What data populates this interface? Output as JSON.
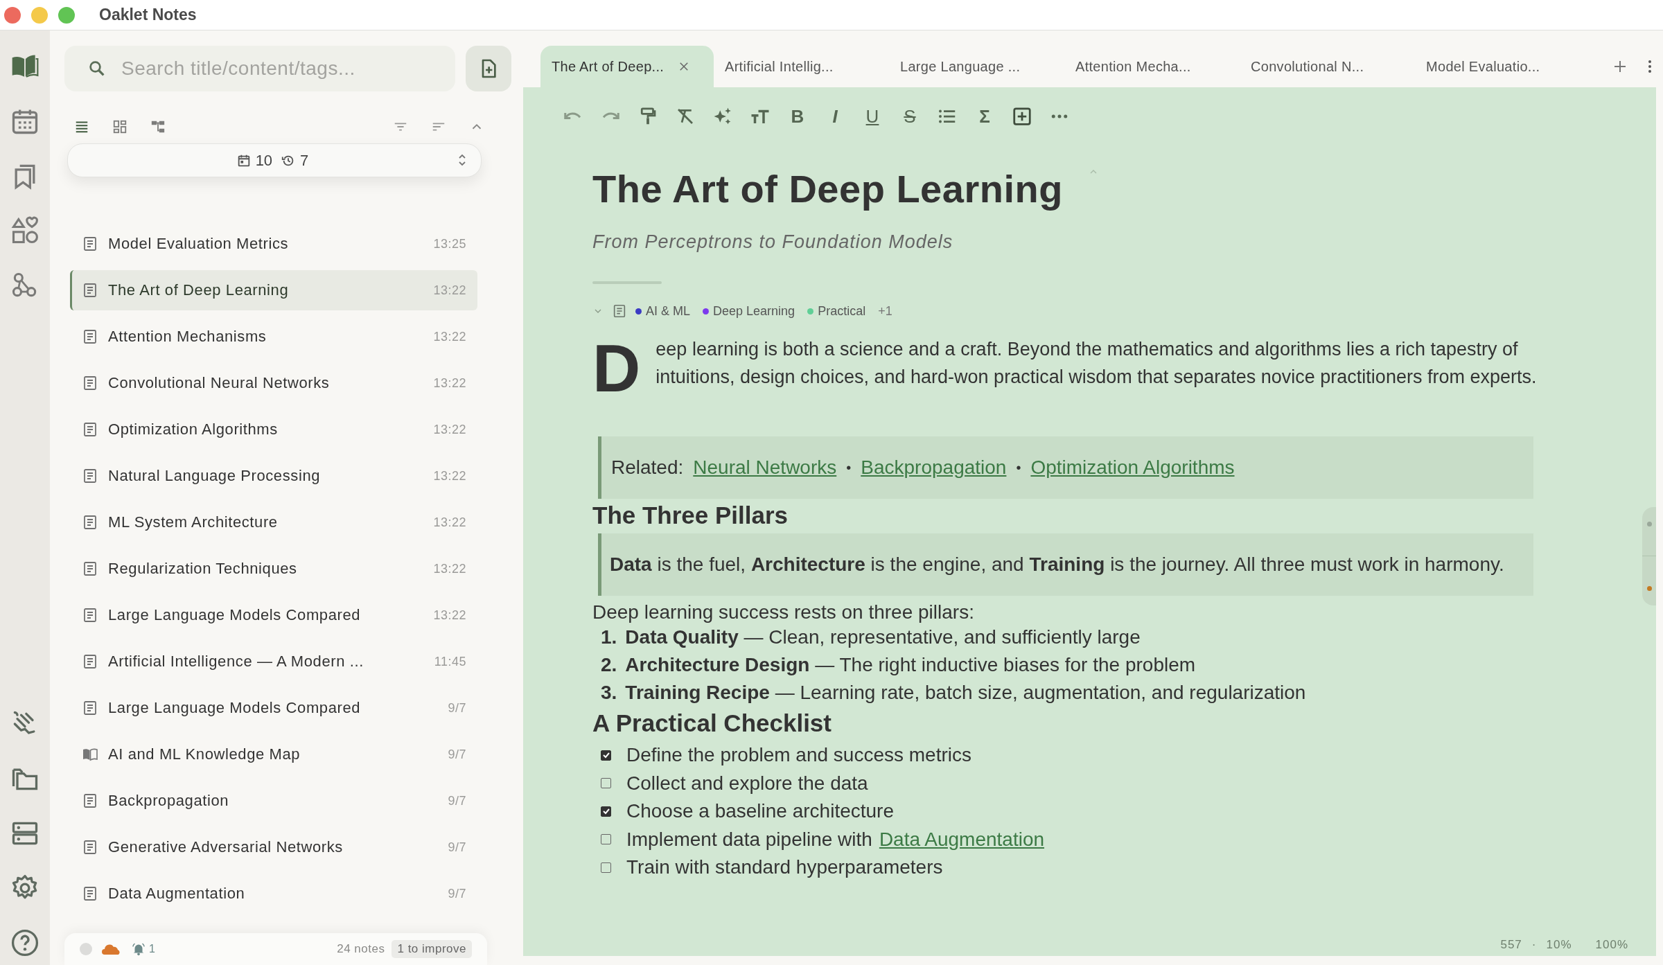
{
  "window": {
    "title": "Oaklet Notes"
  },
  "sidebar": {
    "search": {
      "placeholder": "Search title/content/tags..."
    },
    "date_filter": {
      "today_count": "10",
      "recent_count": "7"
    },
    "notes": [
      {
        "title": "Model Evaluation Metrics",
        "time": "13:25",
        "kind": "note",
        "selected": false
      },
      {
        "title": "The Art of Deep Learning",
        "time": "13:22",
        "kind": "note",
        "selected": true
      },
      {
        "title": "Attention Mechanisms",
        "time": "13:22",
        "kind": "note",
        "selected": false
      },
      {
        "title": "Convolutional Neural Networks",
        "time": "13:22",
        "kind": "note",
        "selected": false
      },
      {
        "title": "Optimization Algorithms",
        "time": "13:22",
        "kind": "note",
        "selected": false
      },
      {
        "title": "Natural Language Processing",
        "time": "13:22",
        "kind": "note",
        "selected": false
      },
      {
        "title": "ML System Architecture",
        "time": "13:22",
        "kind": "note",
        "selected": false
      },
      {
        "title": "Regularization Techniques",
        "time": "13:22",
        "kind": "note",
        "selected": false
      },
      {
        "title": "Large Language Models Compared",
        "time": "13:22",
        "kind": "note",
        "selected": false
      },
      {
        "title": "Artificial Intelligence — A Modern ...",
        "time": "11:45",
        "kind": "note",
        "selected": false
      },
      {
        "title": "Large Language Models Compared",
        "time": "9/7",
        "kind": "note",
        "selected": false
      },
      {
        "title": "AI and ML Knowledge Map",
        "time": "9/7",
        "kind": "map",
        "selected": false
      },
      {
        "title": "Backpropagation",
        "time": "9/7",
        "kind": "note",
        "selected": false
      },
      {
        "title": "Generative Adversarial Networks",
        "time": "9/7",
        "kind": "note",
        "selected": false
      },
      {
        "title": "Data Augmentation",
        "time": "9/7",
        "kind": "note",
        "selected": false
      }
    ],
    "footer": {
      "alerts": "1",
      "note_count": "24 notes",
      "improve_badge": "1 to improve"
    }
  },
  "tabs": [
    {
      "label": "The Art of Deep...",
      "selected": true
    },
    {
      "label": "Artificial Intellig...",
      "selected": false
    },
    {
      "label": "Large Language ...",
      "selected": false
    },
    {
      "label": "Attention Mecha...",
      "selected": false
    },
    {
      "label": "Convolutional N...",
      "selected": false
    },
    {
      "label": "Model Evaluatio...",
      "selected": false
    }
  ],
  "toolbar": [
    {
      "kind": "undo"
    },
    {
      "kind": "redo"
    },
    {
      "kind": "paint"
    },
    {
      "kind": "clear"
    },
    {
      "kind": "sparkle"
    },
    {
      "kind": "textsize"
    },
    {
      "kind": "bold",
      "label": "B"
    },
    {
      "kind": "italic",
      "label": "I"
    },
    {
      "kind": "underline",
      "label": "U"
    },
    {
      "kind": "strike",
      "label": "S"
    },
    {
      "kind": "list"
    },
    {
      "kind": "sigma",
      "label": "Σ"
    },
    {
      "kind": "addbox"
    },
    {
      "kind": "more"
    }
  ],
  "document": {
    "title": "The Art of Deep Learning",
    "subtitle": "From Perceptrons to Foundation Models",
    "tags": [
      {
        "label": "AI & ML",
        "color": "#3b3bc4"
      },
      {
        "label": "Deep Learning",
        "color": "#7c3aed"
      },
      {
        "label": "Practical",
        "color": "#5fcf96"
      }
    ],
    "more_tags": "+1",
    "drop_cap": "D",
    "intro": "eep learning is both a science and a craft. Beyond the mathematics and algorithms lies a rich tapestry of intuitions, design choices, and hard-won practical wisdom that separates novice practitioners from experts.",
    "related": {
      "label": "Related:",
      "links": [
        "Neural Networks",
        "Backpropagation",
        "Optimization Algorithms"
      ],
      "separator": "•"
    },
    "heading_1": "The Three Pillars",
    "quote": "**Data** is the fuel, **Architecture** is the engine, and **Training** is the journey. All three must work in harmony.",
    "paragraph": "Deep learning success rests on three pillars:",
    "pillars": [
      {
        "number": "1.",
        "text": "**Data Quality** — Clean, representative, and sufficiently large"
      },
      {
        "number": "2.",
        "text": "**Architecture Design** — The right inductive biases for the problem"
      },
      {
        "number": "3.",
        "text": "**Training Recipe** — Learning rate, batch size, augmentation, and regularization"
      }
    ],
    "heading_2": "A Practical Checklist",
    "checklist": [
      {
        "text": "Define the problem and success metrics",
        "checked": true
      },
      {
        "text": "Collect and explore the data",
        "checked": false
      },
      {
        "text": "Choose a baseline architecture",
        "checked": true
      },
      {
        "text": "Implement data pipeline with",
        "link": "Data Augmentation",
        "checked": false
      },
      {
        "text": "Train with standard hyperparameters",
        "checked": false
      }
    ]
  },
  "status_bar": {
    "word_count": "557",
    "separator": "·",
    "progress": "10%",
    "zoom": "100%"
  }
}
